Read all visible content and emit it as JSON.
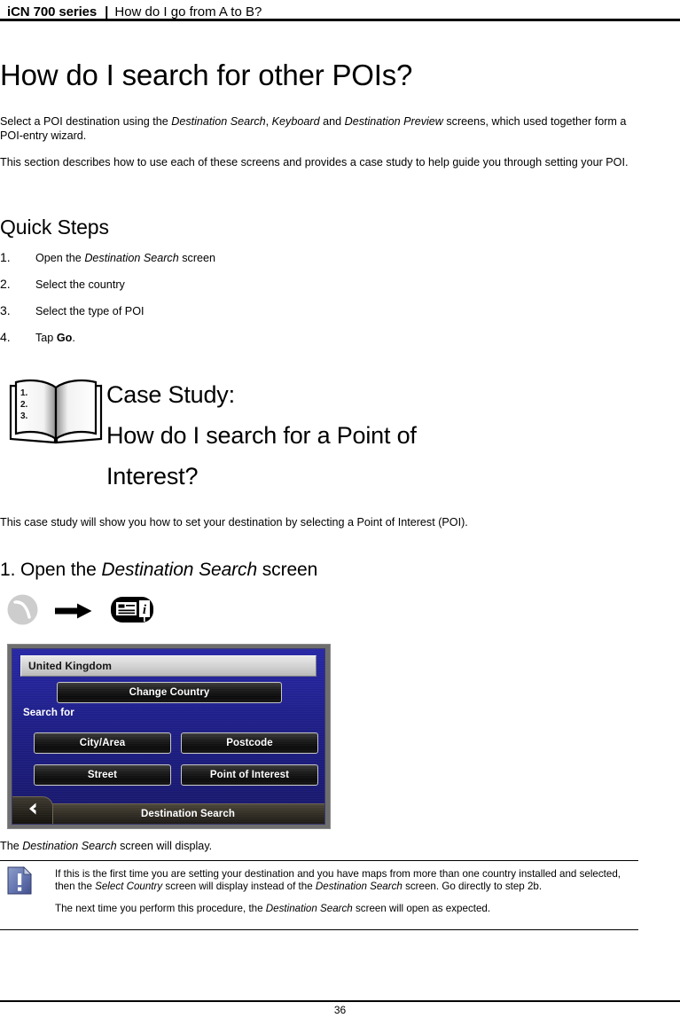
{
  "header": {
    "series": "iCN 700 series",
    "separator": "|",
    "chapter": "How do I go from A to B?"
  },
  "page_title": "How do I search for other POIs?",
  "intro": {
    "para1_pre": "Select a POI destination using the ",
    "para1_i1": "Destination Search",
    "para1_mid1": ", ",
    "para1_i2": "Keyboard",
    "para1_mid2": " and ",
    "para1_i3": "Destination Preview",
    "para1_post": " screens, which used together form a POI-entry wizard.",
    "para2": "This section describes how to use each of these screens and provides a case study to help guide you through setting your POI."
  },
  "quick_steps": {
    "title": "Quick Steps",
    "items": [
      {
        "num": "1.",
        "pre": "Open the ",
        "ital": "Destination Search",
        "post": " screen"
      },
      {
        "num": "2.",
        "pre": "Select the country",
        "ital": "",
        "post": ""
      },
      {
        "num": "3.",
        "pre": "Select the type of POI",
        "ital": "",
        "post": ""
      },
      {
        "num": "4.",
        "pre": "Tap ",
        "bold": "Go",
        "post": "."
      }
    ]
  },
  "case_study": {
    "icon": "open-book-icon",
    "book_list": [
      "1.",
      "2.",
      "3."
    ],
    "line1": "Case Study:",
    "line2": "How do I search for a Point of",
    "line3": "Interest?",
    "intro": "This case study will show you how to set your destination by selecting a Point of Interest (POI)."
  },
  "step1": {
    "heading_pre": "1. Open the ",
    "heading_ital": "Destination Search",
    "heading_post": " screen",
    "icons": [
      "navigate-road-icon",
      "arrow-right-icon",
      "destination-search-icon"
    ]
  },
  "device_screen": {
    "country_value": "United Kingdom",
    "change_country_label": "Change Country",
    "search_for_label": "Search for",
    "buttons": [
      "City/Area",
      "Postcode",
      "Street",
      "Point of Interest"
    ],
    "status_bar_title": "Destination Search",
    "back_icon": "chevron-left-icon",
    "colors": {
      "screen_blue": "#1d1d86",
      "button_dark": "#131313",
      "button_border": "#c6c6c6",
      "field_silver": "#d2d2d2",
      "status_bar": "#332f26",
      "bezel_grey": "#6e6e6e"
    }
  },
  "caption": {
    "pre": "The ",
    "ital": "Destination Search",
    "post": " screen will display."
  },
  "note": {
    "icon": "note-exclamation-icon",
    "para1_a": "If this is the first time you are setting your destination and you have maps from more than one country installed and selected, then the ",
    "para1_i1": "Select Country",
    "para1_b": " screen will display instead of the ",
    "para1_i2": "Destination Search",
    "para1_c": " screen. Go directly to step 2b.",
    "para2_a": "The next time you perform this procedure, the ",
    "para2_i1": "Destination Search",
    "para2_b": " screen will open as expected."
  },
  "footer": {
    "page_number": "36"
  }
}
